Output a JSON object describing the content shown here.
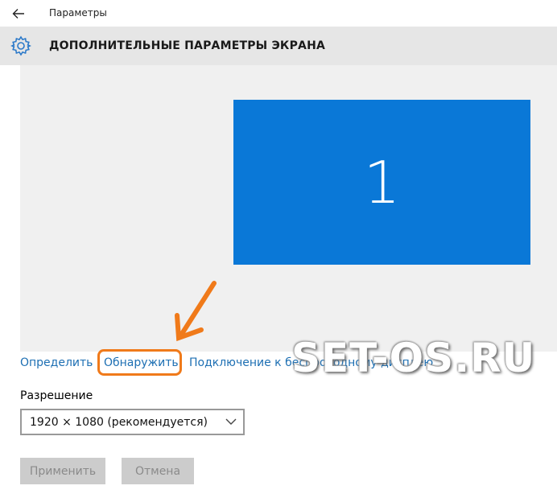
{
  "window": {
    "app_title": "Параметры",
    "page_title": "ДОПОЛНИТЕЛЬНЫЕ ПАРАМЕТРЫ ЭКРАНА",
    "back_icon": "arrow-left-icon",
    "header_icon": "gear-icon"
  },
  "display": {
    "monitor_number": "1",
    "monitor_color": "#0a78d7"
  },
  "links": {
    "identify": "Определить",
    "detect": "Обнаружить",
    "wireless": "Подключение к беспроводному дисплею"
  },
  "resolution": {
    "label": "Разрешение",
    "value": "1920 × 1080 (рекомендуется)"
  },
  "buttons": {
    "apply": "Применить",
    "cancel": "Отмена"
  },
  "annotation": {
    "color": "#f07a1a"
  },
  "watermark": {
    "text": "SET-OS.RU"
  }
}
